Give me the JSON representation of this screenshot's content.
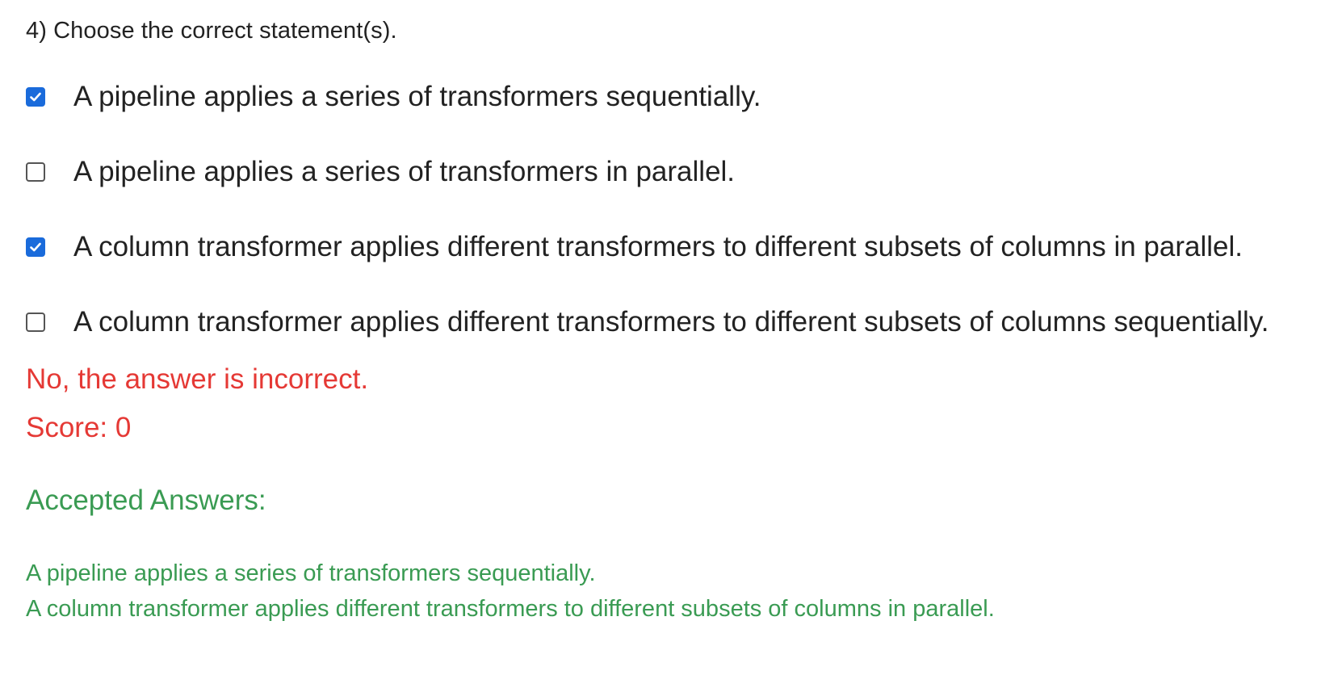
{
  "question": {
    "text": "4) Choose the correct statement(s)."
  },
  "options": [
    {
      "label": "A pipeline applies a series of transformers sequentially.",
      "checked": true
    },
    {
      "label": "A pipeline applies a series of transformers in parallel.",
      "checked": false
    },
    {
      "label": "A column transformer applies different transformers to different subsets of columns in parallel.",
      "checked": true
    },
    {
      "label": "A column transformer applies different transformers to different subsets of columns sequentially.",
      "checked": false
    }
  ],
  "result": {
    "feedback": "No, the answer is incorrect.",
    "score": "Score: 0"
  },
  "accepted": {
    "title": "Accepted Answers:",
    "answers": [
      "A pipeline applies a series of transformers sequentially.",
      "A column transformer applies different transformers to different subsets of columns in parallel."
    ]
  },
  "colors": {
    "checkbox_checked": "#1a6bdb",
    "incorrect": "#e53935",
    "accepted": "#3a9b53"
  }
}
